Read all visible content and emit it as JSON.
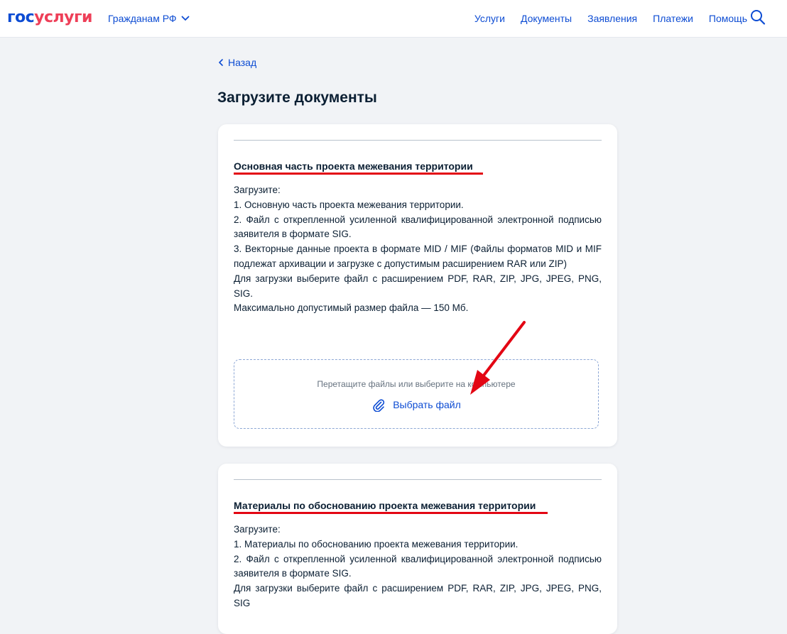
{
  "header": {
    "logo_part1": "гос",
    "logo_part2": "услуги",
    "region_label": "Гражданам РФ",
    "nav": [
      "Услуги",
      "Документы",
      "Заявления",
      "Платежи",
      "Помощь"
    ],
    "search_icon": "search-icon"
  },
  "back_label": "Назад",
  "page_title": "Загрузите документы",
  "sections": [
    {
      "title": "Основная часть проекта межевания территории",
      "lines": [
        "Загрузите:",
        "1. Основную часть проекта межевания территории.",
        "2. Файл с открепленной усиленной квалифицированной электронной подписью заявителя в формате SIG.",
        "3. Векторные данные проекта в формате MID / MIF (Файлы форматов MID и MIF подлежат архивации и загрузке с допустимым расширением RAR или ZIP)",
        "Для загрузки выберите файл с расширением PDF, RAR, ZIP, JPG, JPEG, PNG, SIG.",
        "Максимально допустимый размер файла — 150 Мб."
      ],
      "dropzone_hint": "Перетащите файлы или выберите на компьютере",
      "choose_file_label": "Выбрать файл"
    },
    {
      "title": "Материалы по обоснованию проекта межевания территории",
      "lines": [
        "Загрузите:",
        "1. Материалы по обоснованию проекта межевания территории.",
        "2. Файл с открепленной усиленной квалифицированной электронной подписью заявителя в формате SIG.",
        "Для загрузки выберите файл с расширением PDF, RAR, ZIP, JPG, JPEG, PNG, SIG"
      ]
    }
  ],
  "colors": {
    "brand_blue": "#0d4cd3",
    "brand_red": "#ee3f58",
    "annotation_red": "#e30613",
    "background": "#f1f3f6"
  }
}
